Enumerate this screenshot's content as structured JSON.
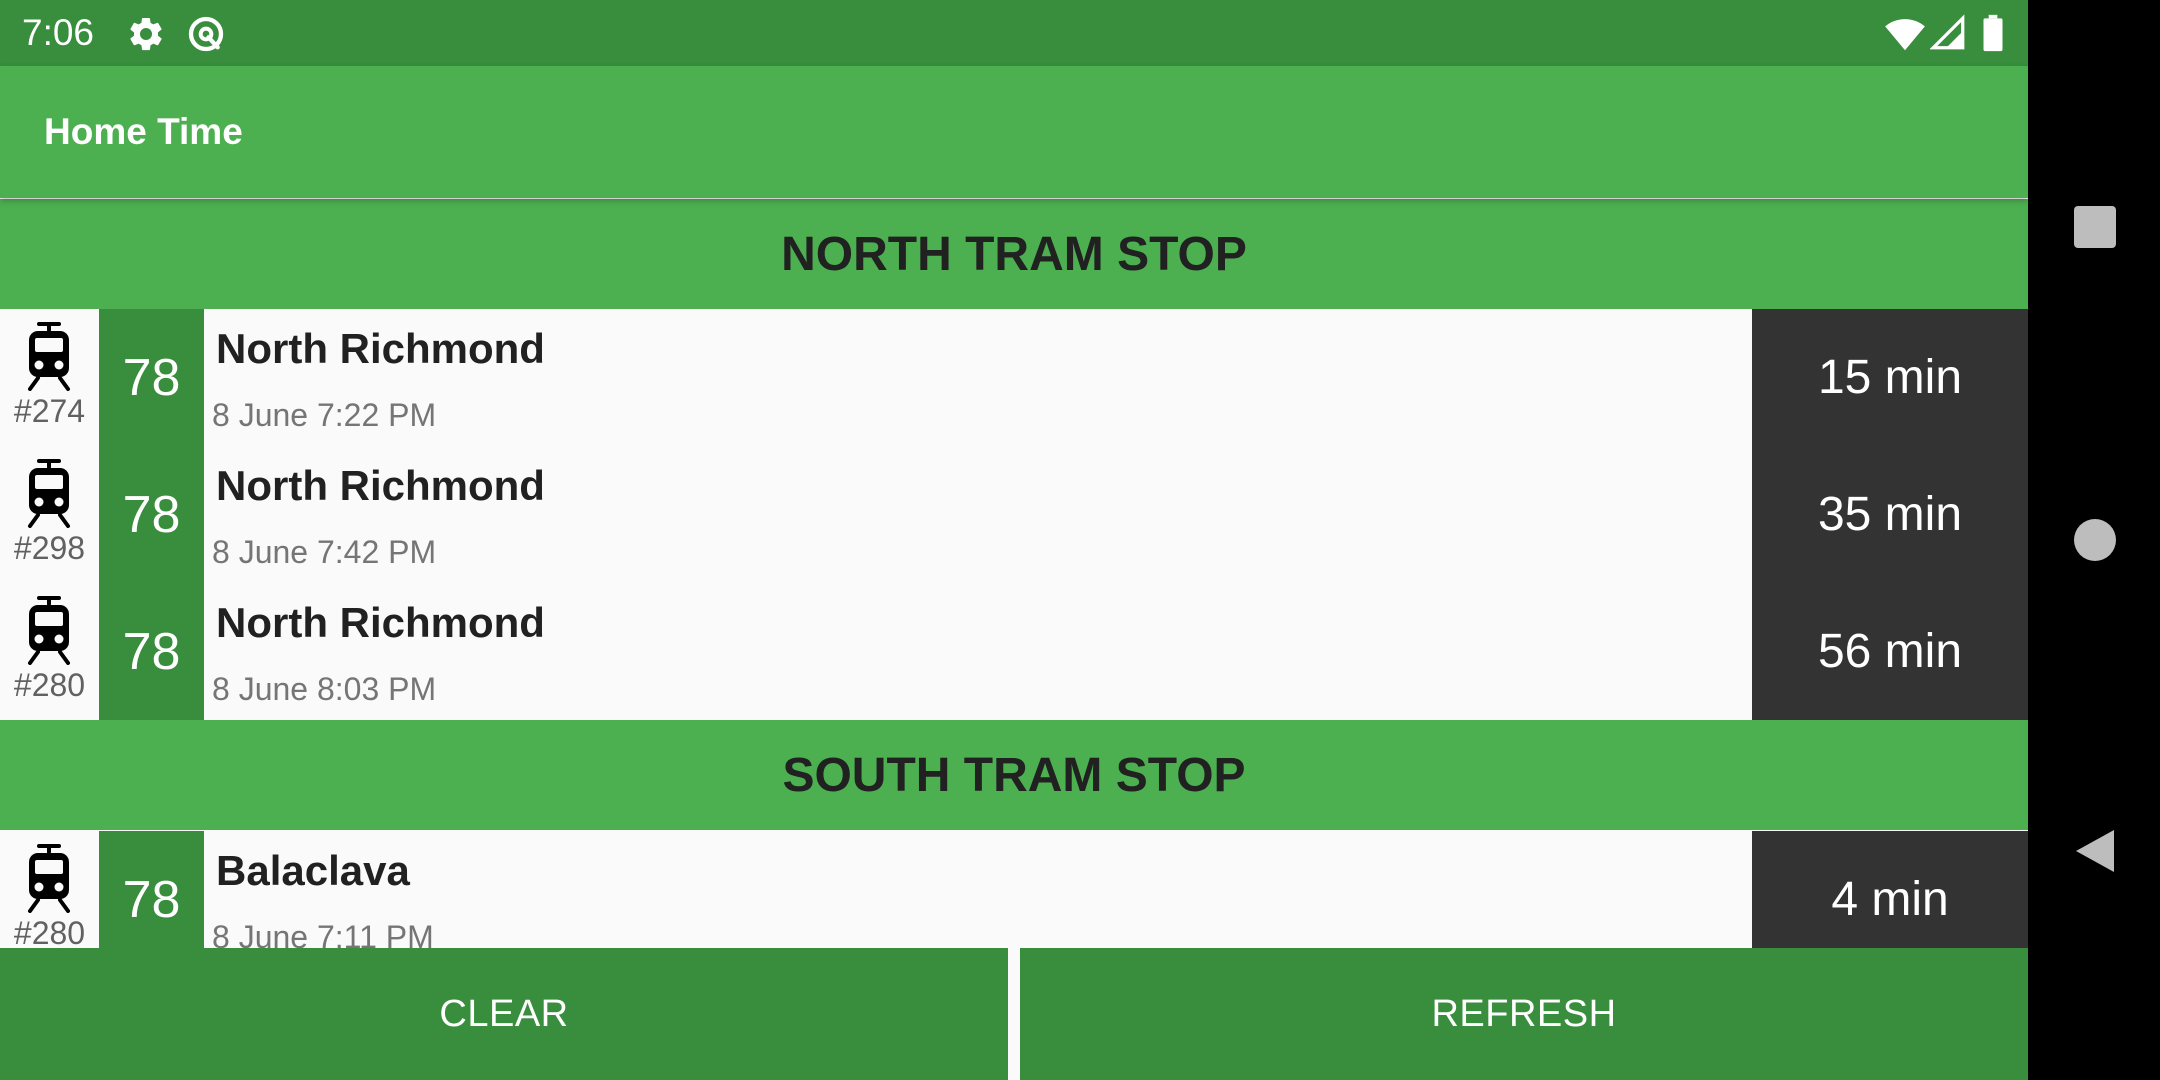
{
  "status_bar": {
    "time": "7:06",
    "icons_left": [
      "gear-icon",
      "sync-icon"
    ],
    "icons_right": [
      "wifi-icon",
      "signal-icon",
      "battery-icon"
    ]
  },
  "app_bar": {
    "title": "Home Time"
  },
  "sections": [
    {
      "title": "NORTH TRAM STOP",
      "rows": [
        {
          "tram_number": "#274",
          "route": "78",
          "destination": "North Richmond",
          "scheduled": "8 June 7:22 PM",
          "eta": "15 min"
        },
        {
          "tram_number": "#298",
          "route": "78",
          "destination": "North Richmond",
          "scheduled": "8 June 7:42 PM",
          "eta": "35 min"
        },
        {
          "tram_number": "#280",
          "route": "78",
          "destination": "North Richmond",
          "scheduled": "8 June 8:03 PM",
          "eta": "56 min"
        }
      ]
    },
    {
      "title": "SOUTH TRAM STOP",
      "rows": [
        {
          "tram_number": "#280",
          "route": "78",
          "destination": "Balaclava",
          "scheduled": "8 June 7:11 PM",
          "eta": "4 min"
        }
      ]
    }
  ],
  "buttons": {
    "clear_label": "CLEAR",
    "refresh_label": "REFRESH"
  },
  "nav_bar": {
    "icons": [
      "recents-icon",
      "home-icon",
      "back-icon"
    ]
  },
  "colors": {
    "status_bar": "#388e3c",
    "app_bar": "#4caf50",
    "route_badge": "#388e3c",
    "eta_cell": "#333333"
  }
}
